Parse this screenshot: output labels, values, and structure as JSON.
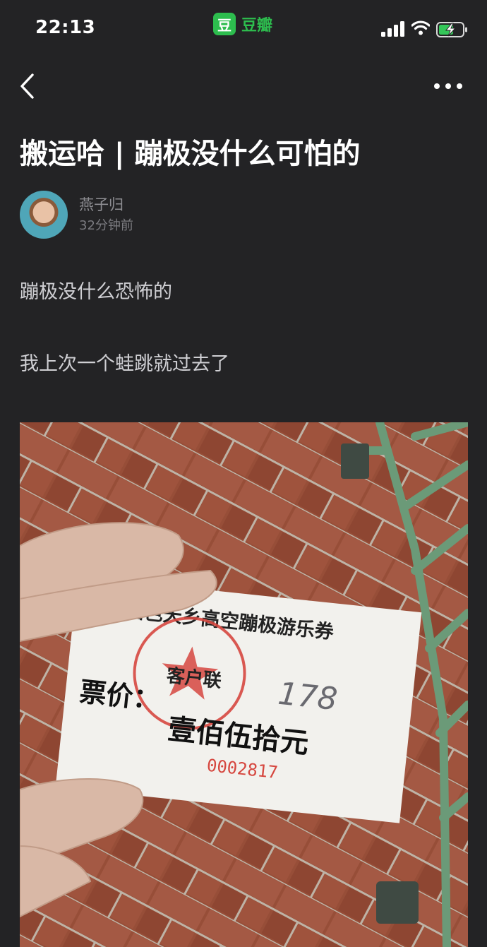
{
  "status_bar": {
    "time": "22:13",
    "app_logo_glyph": "豆",
    "app_name": "豆瓣",
    "brand_color": "#2dbd4e"
  },
  "nav": {
    "back_icon": "chevron-left-icon",
    "more_icon": "ellipsis-icon"
  },
  "post": {
    "title": "搬运哈 | 蹦极没什么可怕的",
    "author": {
      "name": "燕子归",
      "time_ago": "32分钟前"
    },
    "paragraphs": [
      "蹦极没什么恐怖的",
      "我上次一个蛙跳就过去了"
    ],
    "photo": {
      "ticket": {
        "heading": "温江国色天乡高空蹦极游乐券",
        "stamp_label": "客户联",
        "price_label": "票价：",
        "price_value": "壹佰伍拾元",
        "serial": "0002817",
        "handwritten": "178"
      }
    }
  }
}
